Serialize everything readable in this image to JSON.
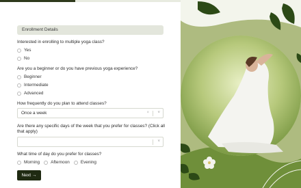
{
  "progress": {
    "fraction": 0.25
  },
  "section": {
    "title": "Enrollment Details"
  },
  "q1": {
    "label": "Interested in enrolling to multiple yoga class?",
    "options": [
      "Yes",
      "No"
    ]
  },
  "q2": {
    "label": "Are you a beginner or do you have previous yoga experience?",
    "options": [
      "Beginner",
      "Intermediate",
      "Advanced"
    ]
  },
  "q3": {
    "label": "How frequently do you plan to attend classes?",
    "value": "Once a week"
  },
  "q4": {
    "label_line1": "Are there any specific days of the week that you prefer for classes? (Click all",
    "label_line2": "that apply)",
    "value": ""
  },
  "q5": {
    "label": "What time of day do you prefer for classes?",
    "options": [
      "Morning",
      "Afternoon",
      "Evening"
    ]
  },
  "next": {
    "label": "Next →"
  },
  "icons": {
    "clear": "×",
    "chevron": "˅"
  },
  "colors": {
    "accent": "#1f2a12",
    "panel": "#a9b77a",
    "leaf": "#2c4a16"
  }
}
